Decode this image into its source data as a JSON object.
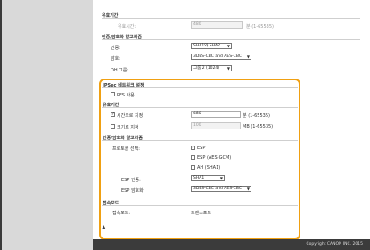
{
  "top_section": {
    "heading": "유효기간",
    "field_label": "유효시간:",
    "field_value": "480",
    "field_unit": "분 (1-65535)"
  },
  "auth_section": {
    "heading": "인증/암호화 알고리즘",
    "auth_label": "인증:",
    "auth_value": "SHA1와 SHA2",
    "enc_label": "암호:",
    "enc_value": "3DES-CBC and AES-CBC",
    "dh_label": "DH 그룹:",
    "dh_value": "그룹 2 (1024)"
  },
  "ipsec": {
    "heading": "IPSec 네트워크 설정",
    "pfs_label": "PFS 사용",
    "pfs_checked": false,
    "validity": {
      "heading": "유효기간",
      "time_label": "시간으로 지정",
      "time_checked": true,
      "time_value": "480",
      "time_unit": "분 (1-65535)",
      "size_label": "크기로 지정",
      "size_checked": false,
      "size_value": "100",
      "size_unit": "MB (1-65535)"
    },
    "algo": {
      "heading": "인증/암호화 알고리즘",
      "proto_label": "프로토콜 선택:",
      "options": [
        {
          "label": "ESP",
          "checked": true
        },
        {
          "label": "ESP (AES-GCM)",
          "checked": false
        },
        {
          "label": "AH (SHA1)",
          "checked": false
        }
      ],
      "esp_auth_label": "ESP 인증:",
      "esp_auth_value": "SHA1",
      "esp_enc_label": "ESP 암호화:",
      "esp_enc_value": "3DES-CBC and AES-CBC"
    },
    "connection": {
      "heading": "접속모드",
      "mode_label": "접속모드:",
      "mode_value": "트랜스포트"
    }
  },
  "footer": {
    "copyright": "Copyright CANON INC. 2015"
  },
  "icons": {
    "up": "up-arrow-icon"
  }
}
